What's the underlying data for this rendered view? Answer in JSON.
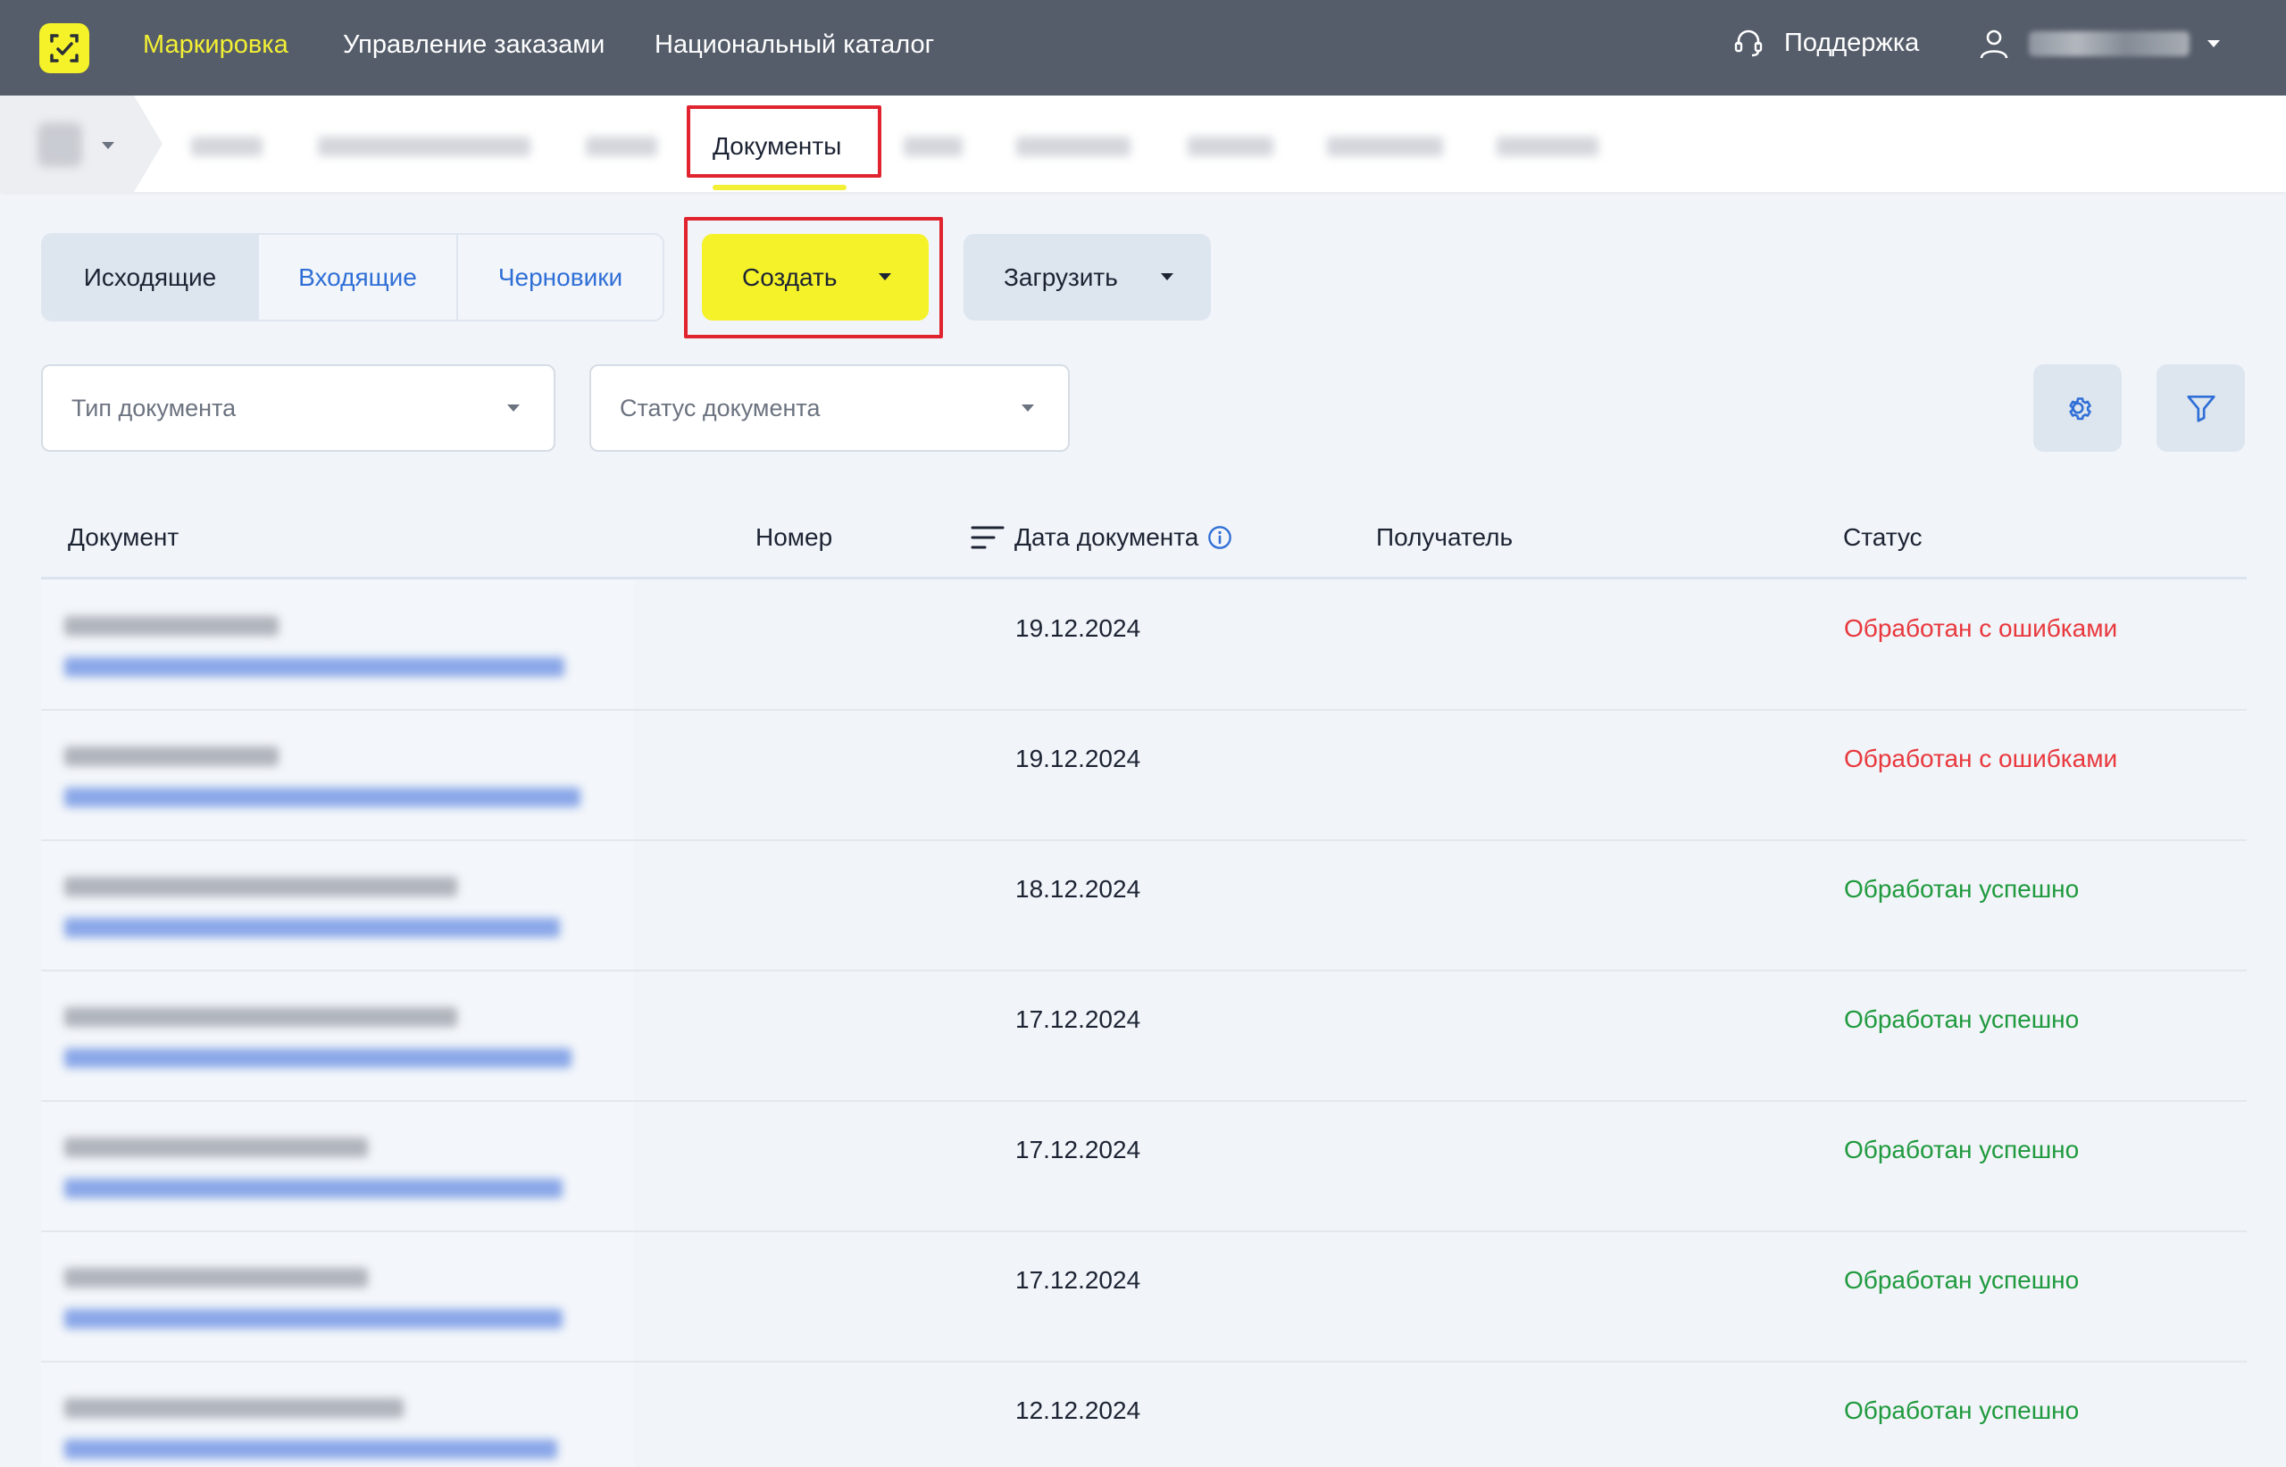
{
  "topnav": {
    "items": [
      "Маркировка",
      "Управление заказами",
      "Национальный каталог"
    ],
    "active_index": 0,
    "support_label": "Поддержка"
  },
  "subnav": {
    "active_label": "Документы"
  },
  "toolbar": {
    "tabs": [
      "Исходящие",
      "Входящие",
      "Черновики"
    ],
    "active_tab": 0,
    "create_label": "Создать",
    "upload_label": "Загрузить"
  },
  "filters": {
    "doc_type_placeholder": "Тип документа",
    "doc_status_placeholder": "Статус документа"
  },
  "table": {
    "columns": [
      "Документ",
      "Номер",
      "Дата документа",
      "Получатель",
      "Статус"
    ],
    "rows": [
      {
        "date": "19.12.2024",
        "status": "Обработан с ошибками",
        "status_kind": "error"
      },
      {
        "date": "19.12.2024",
        "status": "Обработан с ошибками",
        "status_kind": "error"
      },
      {
        "date": "18.12.2024",
        "status": "Обработан успешно",
        "status_kind": "ok"
      },
      {
        "date": "17.12.2024",
        "status": "Обработан успешно",
        "status_kind": "ok"
      },
      {
        "date": "17.12.2024",
        "status": "Обработан успешно",
        "status_kind": "ok"
      },
      {
        "date": "17.12.2024",
        "status": "Обработан успешно",
        "status_kind": "ok"
      },
      {
        "date": "12.12.2024",
        "status": "Обработан успешно",
        "status_kind": "ok"
      }
    ]
  },
  "colors": {
    "accent_yellow": "#f5f22a",
    "topbar_bg": "#555d6a",
    "status_error": "#e8383d",
    "status_ok": "#1f9a3e",
    "highlight_red": "#e0232e"
  }
}
